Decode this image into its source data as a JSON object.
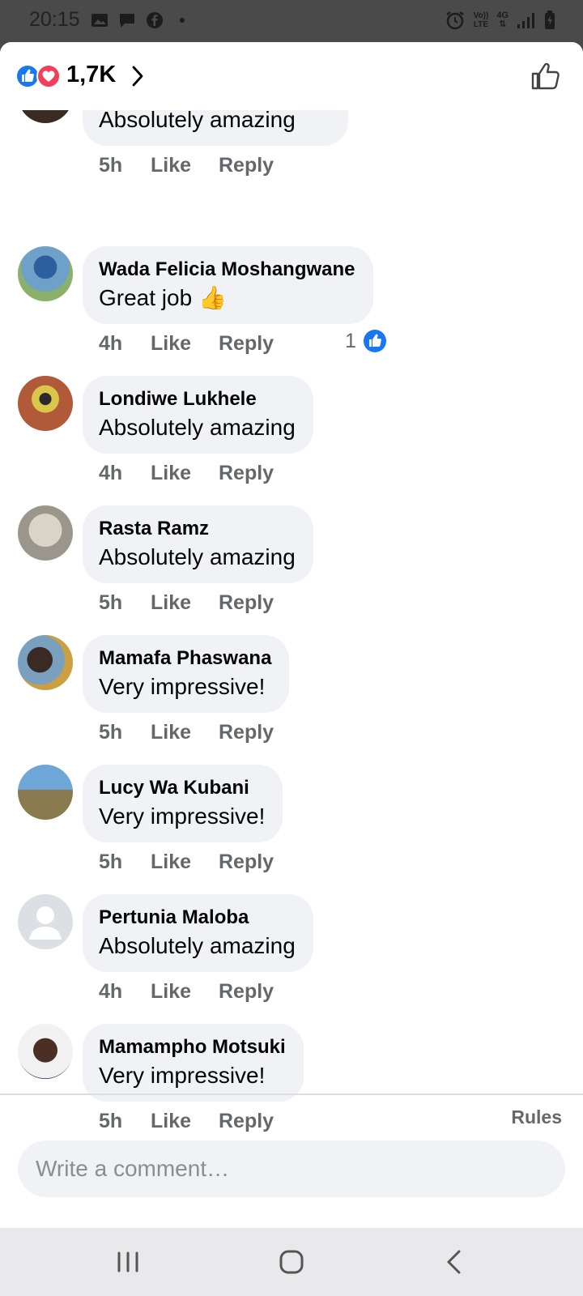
{
  "status_bar": {
    "time": "20:15",
    "network_label_top": "Vo))",
    "network_label_bottom": "LTE",
    "network_type": "4G"
  },
  "reactions": {
    "count": "1,7K",
    "icons": [
      "like-icon",
      "love-icon"
    ],
    "colors": {
      "like": "#1877f2",
      "love": "#f33e58"
    }
  },
  "comments": [
    {
      "name": "",
      "text": "Absolutely amazing",
      "time": "5h",
      "like_label": "Like",
      "reply_label": "Reply",
      "likes": ""
    },
    {
      "name": "Wada Felicia Moshangwane",
      "text": "Great job 👍",
      "time": "4h",
      "like_label": "Like",
      "reply_label": "Reply",
      "likes": "1"
    },
    {
      "name": "Londiwe Lukhele",
      "text": "Absolutely amazing",
      "time": "4h",
      "like_label": "Like",
      "reply_label": "Reply",
      "likes": ""
    },
    {
      "name": "Rasta Ramz",
      "text": "Absolutely amazing",
      "time": "5h",
      "like_label": "Like",
      "reply_label": "Reply",
      "likes": ""
    },
    {
      "name": "Mamafa Phaswana",
      "text": "Very impressive!",
      "time": "5h",
      "like_label": "Like",
      "reply_label": "Reply",
      "likes": ""
    },
    {
      "name": "Lucy Wa Kubani",
      "text": "Very impressive!",
      "time": "5h",
      "like_label": "Like",
      "reply_label": "Reply",
      "likes": ""
    },
    {
      "name": "Pertunia Maloba",
      "text": "Absolutely amazing",
      "time": "4h",
      "like_label": "Like",
      "reply_label": "Reply",
      "likes": ""
    },
    {
      "name": "Mamampho Motsuki",
      "text": "Very impressive!",
      "time": "5h",
      "like_label": "Like",
      "reply_label": "Reply",
      "likes": ""
    }
  ],
  "composer": {
    "rules_label": "Rules",
    "placeholder": "Write a comment…"
  },
  "colors": {
    "accent": "#1877f2",
    "bubble": "#f0f2f5",
    "muted_text": "#65676b"
  }
}
